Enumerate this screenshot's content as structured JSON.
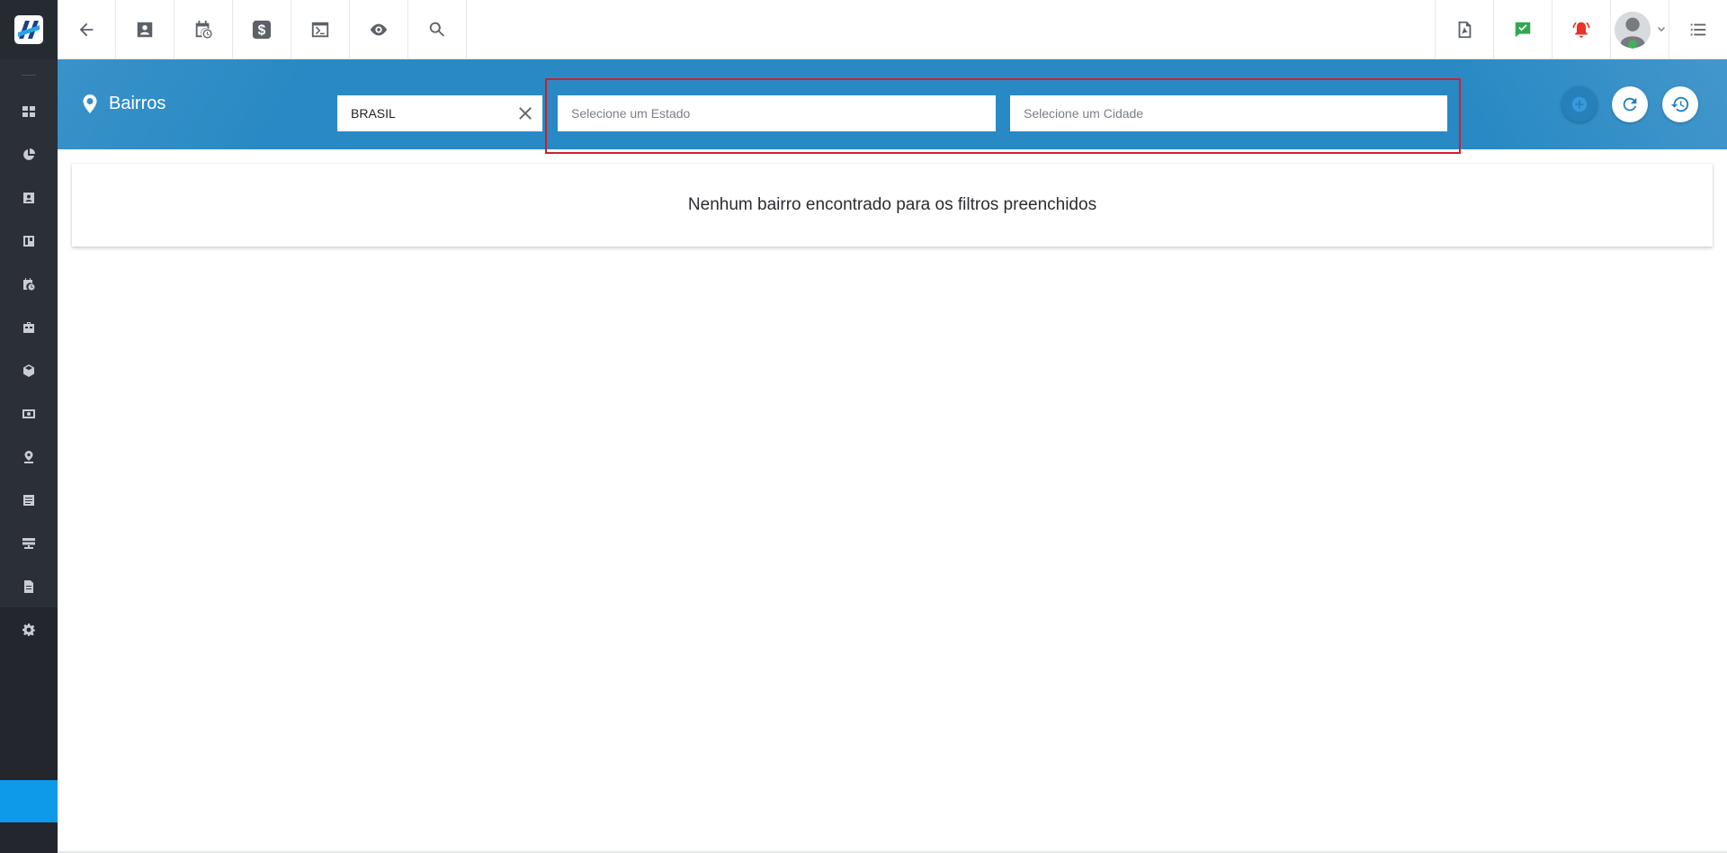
{
  "app": {
    "page_title": "Bairros",
    "accent_color": "#2989c4",
    "sidebar_active_color": "#0e9ae8"
  },
  "topbar": {
    "left_icons": [
      "back-arrow-icon",
      "contact-card-icon",
      "calendar-clock-icon",
      "dollar-icon",
      "terminal-icon",
      "eye-icon",
      "search-icon"
    ],
    "right_icons": [
      "pdf-icon",
      "chat-check-icon",
      "alarm-bell-icon",
      "user-avatar",
      "list-menu-icon"
    ]
  },
  "sidebar": {
    "items": [
      "dashboard-icon",
      "pie-chart-icon",
      "contacts-icon",
      "board-icon",
      "calendar-clock-icon",
      "briefcase-icon",
      "package-icon",
      "cash-icon",
      "map-pin-icon",
      "list-document-icon",
      "server-icon",
      "file-icon",
      "settings-gear-icon"
    ]
  },
  "filters": {
    "country": {
      "value": "BRASIL"
    },
    "state": {
      "placeholder": "Selecione um Estado",
      "value": ""
    },
    "city": {
      "placeholder": "Selecione um Cidade",
      "value": ""
    }
  },
  "actions": [
    "add-icon",
    "refresh-icon",
    "history-icon"
  ],
  "results": {
    "empty_message": "Nenhum bairro encontrado para os filtros preenchidos"
  }
}
